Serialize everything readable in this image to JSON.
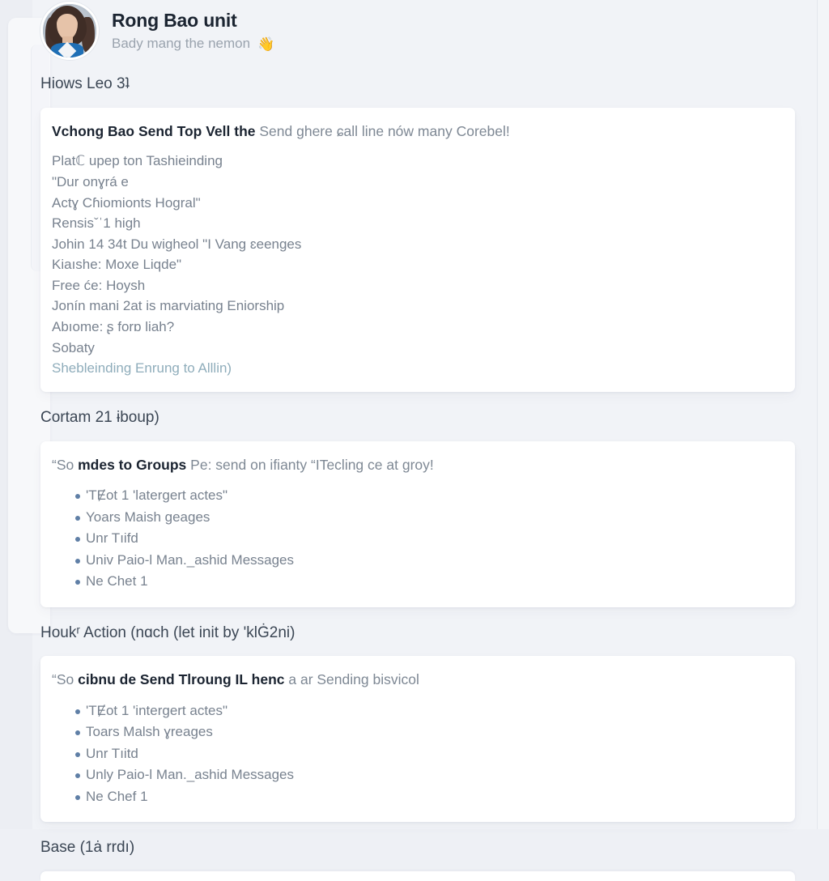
{
  "header": {
    "avatar": "user-photo-avatar",
    "name": "Rong Bao unit",
    "subtitle": "Bady mang the nemon",
    "emoji_icon": "waving-hand-icon",
    "emoji_glyph": "👋",
    "accent_emoji_color": "#f0923c"
  },
  "colors": {
    "page_background": "#f1f3f7",
    "card_background": "#ffffff",
    "heading_text": "#3b4654",
    "body_text": "#78828f",
    "strong_text": "#1b2431",
    "link_text": "#8fadbb",
    "bullet": "#5f7fa6"
  },
  "sections": [
    {
      "heading": "Hiows Leo 3ʇ",
      "lead_bold": "Vchong Bao Send Top Vell the",
      "lead_rest": " Send ghere ɕall line nów many Corebel!",
      "lines": [
        {
          "text": "Platℂ upep ton Tashieinding",
          "style": "plain"
        },
        {
          "text": "\"Dur onɣrá e",
          "style": "plain"
        },
        {
          "text": "Actɣ Cɦiomionts Hogral\"",
          "style": "plain"
        },
        {
          "text": "Rensisˇˈ1 high",
          "style": "plain"
        },
        {
          "text": "Johin 14 34t Du wigheol \"I Vang ɛeenges",
          "style": "plain"
        },
        {
          "text": "Kiaıshe: Moxe Liqde\"",
          "style": "plain"
        },
        {
          "text": "Free će: Hoysh",
          "style": "plain"
        },
        {
          "text": "Jonín mani 2at is marviating Eniorship",
          "style": "plain"
        },
        {
          "text": "Abıome: ʂ forɒ liah?",
          "style": "plain"
        },
        {
          "text": "Sobaty",
          "style": "plain"
        },
        {
          "text": "Shebleinding Enrung to Alllin)",
          "style": "link"
        }
      ]
    },
    {
      "heading": "Cortam 21 ɨboup)",
      "lead_prefix": "“So ",
      "lead_bold": "mdes to Groups",
      "lead_rest": " Pe: send on ifianty “ITecling ce at groy!",
      "bullets": [
        "'TɆot 1 'latergert actes\"",
        "Yoars Maish ɡeages",
        "Unr Tıifd",
        "Univ Paio-l Man._ashid Messages",
        "Ne Chet 1"
      ]
    },
    {
      "heading": "Houkʳ Action (nɑch (let init by 'klĠ2ni)",
      "lead_prefix": "“So ",
      "lead_bold": "cibnu de Send Tlroung IL henc",
      "lead_rest": " a ar Sending bisvicol",
      "bullets": [
        "'TɆot 1 'intergert actes\"",
        "Toars Malsh ɣreages",
        "Unr Tıitd",
        "Unly Paio-l Man._ashid Messages",
        "Ne Chef 1"
      ]
    },
    {
      "heading": "Base (1ȧ rrdı)"
    }
  ]
}
